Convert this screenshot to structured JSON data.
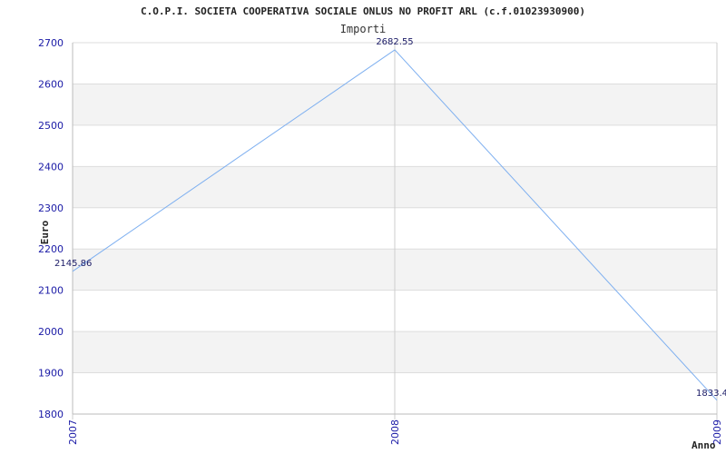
{
  "chart_data": {
    "type": "line",
    "title": "C.O.P.I. SOCIETA COOPERATIVA SOCIALE ONLUS NO PROFIT ARL (c.f.01023930900)",
    "subtitle": "Importi",
    "xlabel": "Anno",
    "ylabel": "Euro",
    "categories": [
      "2007",
      "2008",
      "2009"
    ],
    "series": [
      {
        "values": [
          2145.86,
          2682.55,
          1833.4
        ]
      }
    ],
    "data_labels": [
      "2145.86",
      "2682.55",
      "1833.4"
    ],
    "ylim": [
      1800,
      2700
    ],
    "yticks": [
      1800,
      1900,
      2000,
      2100,
      2200,
      2300,
      2400,
      2500,
      2600,
      2700
    ],
    "grid": true,
    "band_color": "#f3f3f3",
    "line_color": "#7fb0f0",
    "tick_color": "#1a1aa6"
  }
}
